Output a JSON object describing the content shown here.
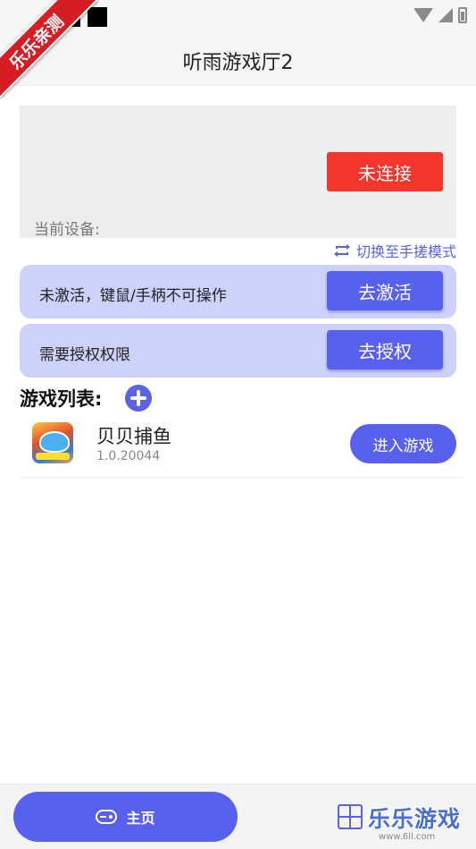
{
  "ribbon": {
    "text": "乐乐亲测"
  },
  "header": {
    "title": "听雨游戏厅2"
  },
  "device": {
    "connect_button": "未连接",
    "current_device_label": "当前设备:"
  },
  "switch_mode": {
    "label": "切换至手搓模式",
    "icon": "swap-icon"
  },
  "activation_card": {
    "text": "未激活，键鼠/手柄不可操作",
    "button": "去激活"
  },
  "permission_card": {
    "text": "需要授权权限",
    "button": "去授权"
  },
  "game_list": {
    "title": "游戏列表:",
    "add_icon": "plus-circle-icon",
    "games": [
      {
        "name": "贝贝捕鱼",
        "version": "1.0.20044",
        "enter_button": "进入游戏"
      }
    ]
  },
  "bottom_nav": {
    "home_label": "主页",
    "home_icon": "gamepad-icon",
    "grid_icon": "grid-icon"
  },
  "watermark": {
    "main": "乐乐游戏",
    "sub": "www.6ll.com"
  },
  "colors": {
    "accent": "#5861ef",
    "accent_light": "#ccd2fb",
    "danger": "#f5362c",
    "ribbon": "#d51e24"
  }
}
